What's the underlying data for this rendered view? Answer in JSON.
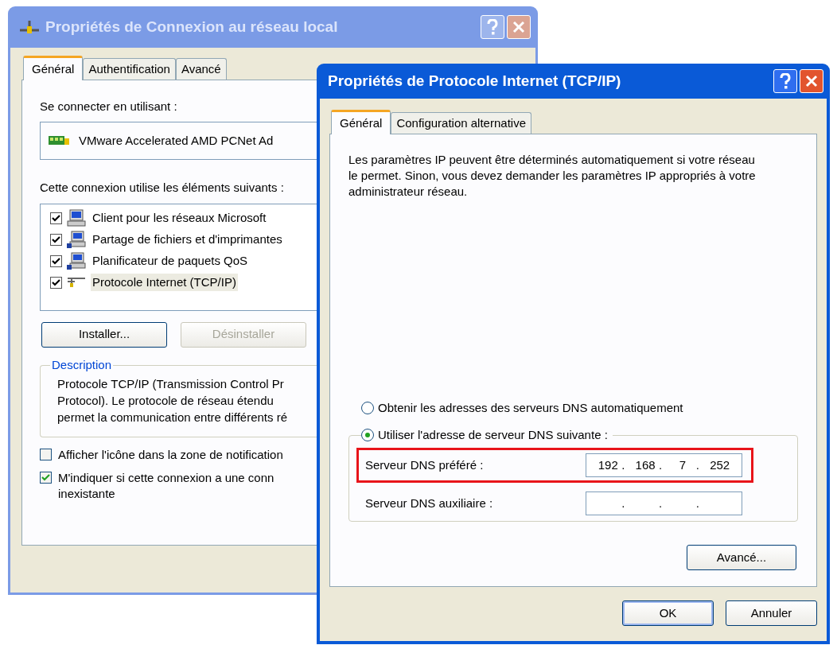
{
  "back_window": {
    "title": "Propriétés de Connexion au réseau local",
    "active": false,
    "tabs": [
      {
        "label": "Général",
        "selected": true
      },
      {
        "label": "Authentification",
        "selected": false
      },
      {
        "label": "Avancé",
        "selected": false
      }
    ],
    "connect_using": {
      "label": "Se connecter en utilisant :",
      "adapter": "VMware Accelerated AMD PCNet Ad"
    },
    "components": {
      "label": "Cette connexion utilise les éléments suivants :",
      "items": [
        {
          "kind": "client",
          "label": "Client pour les réseaux Microsoft",
          "checked": true,
          "selected": false
        },
        {
          "kind": "service",
          "label": "Partage de fichiers et d'imprimantes",
          "checked": true,
          "selected": false
        },
        {
          "kind": "service",
          "label": "Planificateur de paquets QoS",
          "checked": true,
          "selected": false
        },
        {
          "kind": "protocol",
          "label": "Protocole Internet (TCP/IP)",
          "checked": true,
          "selected": true
        }
      ]
    },
    "buttons": [
      {
        "label": "Installer...",
        "disabled": false
      },
      {
        "label": "Désinstaller",
        "disabled": true
      }
    ],
    "description": {
      "title": "Description",
      "lines": [
        "Protocole TCP/IP (Transmission Control Pr",
        "Protocol). Le protocole de réseau étendu",
        "permet la communication entre différents ré"
      ]
    },
    "options": [
      {
        "lines": [
          "Afficher l'icône dans la zone de notification"
        ],
        "checked": false
      },
      {
        "lines": [
          "M'indiquer si cette connexion a une conn",
          "inexistante"
        ],
        "checked": true
      }
    ]
  },
  "front_window": {
    "title": "Propriétés de Protocole Internet (TCP/IP)",
    "active": true,
    "tabs": [
      {
        "label": "Général",
        "selected": true
      },
      {
        "label": "Configuration alternative",
        "selected": false
      }
    ],
    "intro": "Les paramètres IP peuvent être déterminés automatiquement si votre réseau le permet. Sinon, vous devez demander les paramètres IP appropriés à votre administrateur réseau.",
    "dns_modes": [
      {
        "label": "Obtenir les adresses des serveurs DNS automatiquement",
        "selected": false
      },
      {
        "label": "Utiliser l'adresse de serveur DNS suivante :",
        "selected": true
      }
    ],
    "dns_fields": [
      {
        "label": "Serveur DNS préféré :",
        "separator": ".",
        "octets": [
          "192",
          "168",
          "7",
          "252"
        ],
        "highlighted": true
      },
      {
        "label": "Serveur DNS auxiliaire :",
        "separator": ".",
        "highlighted": false
      }
    ],
    "advanced_button": "Avancé...",
    "buttons": [
      {
        "label": "OK",
        "default": true
      },
      {
        "label": "Annuler",
        "default": false
      }
    ]
  }
}
